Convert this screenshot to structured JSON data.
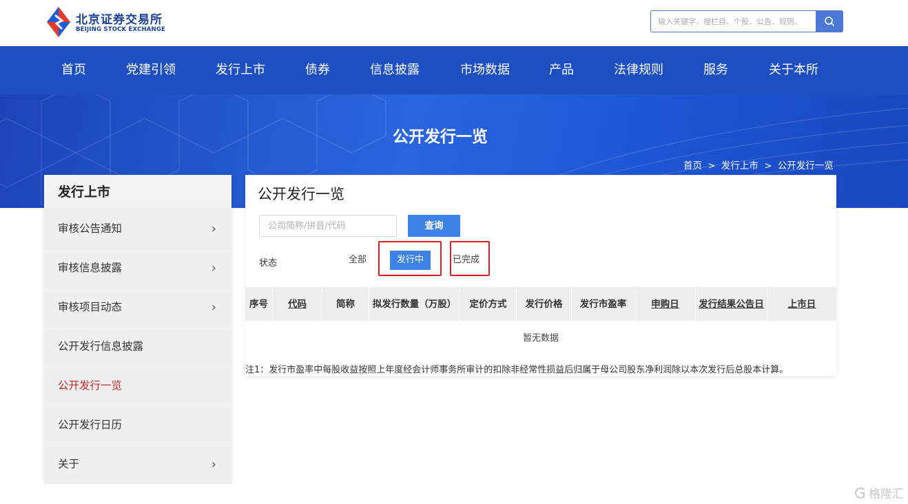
{
  "brand": {
    "name_cn": "北京证券交易所",
    "name_en": "BEIJING STOCK EXCHANGE",
    "colors": {
      "primary": "#1d4ec2",
      "accent_red": "#c1272d",
      "button_blue": "#3d82e5"
    }
  },
  "search": {
    "placeholder": "输入关键字，搜栏目、个股、公告、规则、",
    "icon": "search-icon"
  },
  "nav": {
    "items": [
      {
        "label": "首页"
      },
      {
        "label": "党建引领"
      },
      {
        "label": "发行上市"
      },
      {
        "label": "债券"
      },
      {
        "label": "信息披露"
      },
      {
        "label": "市场数据"
      },
      {
        "label": "产品"
      },
      {
        "label": "法律规则"
      },
      {
        "label": "服务"
      },
      {
        "label": "关于本所"
      }
    ]
  },
  "banner": {
    "title": "公开发行一览",
    "breadcrumb": [
      "首页",
      ">",
      "发行上市",
      ">",
      "公开发行一览"
    ]
  },
  "sidebar": {
    "title": "发行上市",
    "items": [
      {
        "label": "审核公告通知",
        "arrow": "›"
      },
      {
        "label": "审核信息披露",
        "arrow": "›"
      },
      {
        "label": "审核项目动态",
        "arrow": "›"
      },
      {
        "label": "公开发行信息披露",
        "arrow": ""
      },
      {
        "label": "公开发行一览",
        "arrow": ""
      },
      {
        "label": "公开发行日历",
        "arrow": ""
      },
      {
        "label": "关于",
        "arrow": "›"
      }
    ]
  },
  "main": {
    "title": "公开发行一览",
    "query": {
      "placeholder": "公司简称/拼音/代码",
      "value": "",
      "button": "查询"
    },
    "status": {
      "label": "状态",
      "options": [
        "全部",
        "发行中",
        "已完成"
      ],
      "selected": "发行中"
    },
    "table": {
      "headers": [
        "序号",
        "代码",
        "简称",
        "拟发行数量（万股）",
        "定价方式",
        "发行价格",
        "发行市盈率",
        "申购日",
        "发行结果公告日",
        "上市日"
      ],
      "rows": [],
      "empty_text": "暂无数据"
    },
    "note": "注1：发行市盈率中每股收益按照上年度经会计师事务所审计的扣除非经常性损益后归属于母公司股东净利润除以本次发行后总股本计算。"
  },
  "watermark": "格隆汇"
}
